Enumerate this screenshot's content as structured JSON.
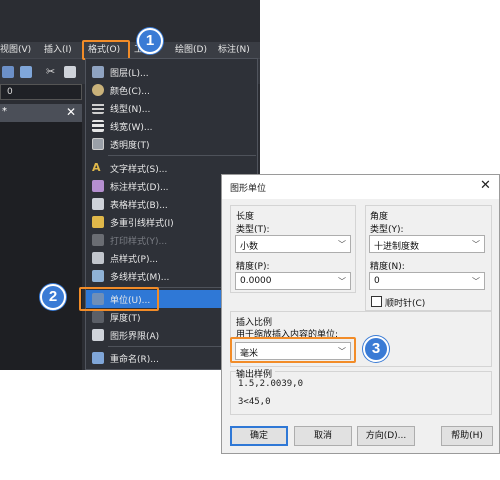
{
  "menubar": {
    "items": [
      "视图(V)",
      "插入(I)",
      "格式(O)",
      "工",
      "绘图(D)",
      "标注(N)"
    ]
  },
  "layerbar": {
    "value": "0"
  },
  "filetab": {
    "marker": "*"
  },
  "format_menu": {
    "items": [
      {
        "label": "图层(L)...",
        "icon": "layers-icon",
        "state": "normal"
      },
      {
        "label": "颜色(C)...",
        "icon": "color-palette-icon",
        "state": "normal"
      },
      {
        "label": "线型(N)...",
        "icon": "linetype-icon",
        "state": "normal"
      },
      {
        "label": "线宽(W)...",
        "icon": "lineweight-icon",
        "state": "normal"
      },
      {
        "label": "透明度(T)",
        "icon": "transparency-icon",
        "state": "normal"
      },
      {
        "label": "文字样式(S)...",
        "icon": "text-style-icon",
        "state": "normal"
      },
      {
        "label": "标注样式(D)...",
        "icon": "dimension-style-icon",
        "state": "normal"
      },
      {
        "label": "表格样式(B)...",
        "icon": "table-style-icon",
        "state": "normal"
      },
      {
        "label": "多重引线样式(I)",
        "icon": "multileader-style-icon",
        "state": "normal"
      },
      {
        "label": "打印样式(Y)...",
        "icon": "plot-style-icon",
        "state": "disabled"
      },
      {
        "label": "点样式(P)...",
        "icon": "point-style-icon",
        "state": "normal"
      },
      {
        "label": "多线样式(M)...",
        "icon": "multiline-style-icon",
        "state": "normal"
      },
      {
        "label": "单位(U)...",
        "icon": "units-icon",
        "state": "selected"
      },
      {
        "label": "厚度(T)",
        "icon": "thickness-icon",
        "state": "normal"
      },
      {
        "label": "图形界限(A)",
        "icon": "limits-icon",
        "state": "normal"
      },
      {
        "label": "重命名(R)...",
        "icon": "rename-icon",
        "state": "normal"
      }
    ]
  },
  "steps": [
    "1",
    "2",
    "3"
  ],
  "dialog": {
    "title": "图形单位",
    "length": {
      "group_label": "长度",
      "type_label": "类型(T):",
      "type_value": "小数",
      "precision_label": "精度(P):",
      "precision_value": "0.0000"
    },
    "angle": {
      "group_label": "角度",
      "type_label": "类型(Y):",
      "type_value": "十进制度数",
      "precision_label": "精度(N):",
      "precision_value": "0",
      "clockwise_label": "顺时针(C)",
      "clockwise_checked": false
    },
    "insertion": {
      "group_label": "插入比例",
      "desc": "用于缩放插入内容的单位:",
      "value": "毫米"
    },
    "sample": {
      "group_label": "输出样例",
      "line1": "1.5,2.0039,0",
      "line2": "3<45,0"
    },
    "buttons": {
      "ok": "确定",
      "cancel": "取消",
      "direction": "方向(D)...",
      "help": "帮助(H)"
    }
  },
  "colors": {
    "accent": "#2f78d6",
    "highlight": "#f28c28",
    "badge": "#3a7bd5"
  }
}
